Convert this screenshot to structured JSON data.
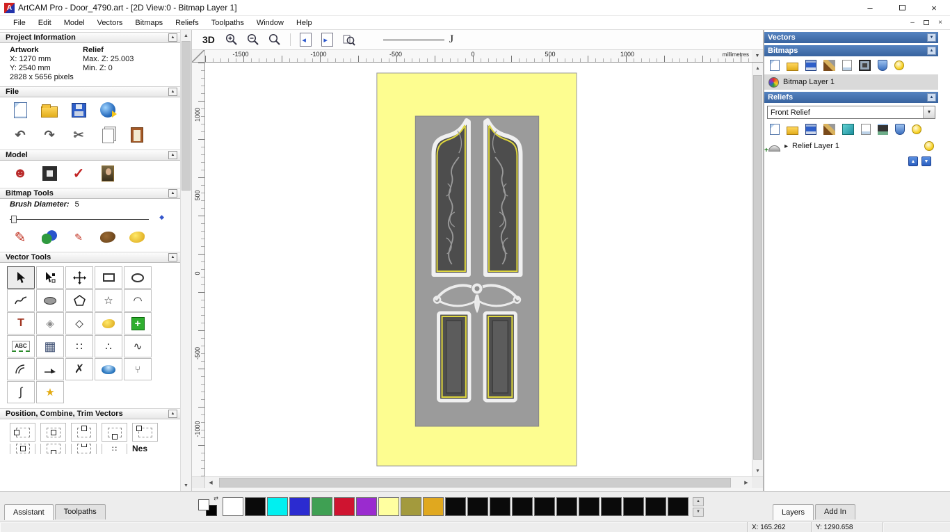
{
  "window": {
    "title": "ArtCAM Pro - Door_4790.art - [2D View:0 - Bitmap Layer 1]",
    "menus": [
      "File",
      "Edit",
      "Model",
      "Vectors",
      "Bitmaps",
      "Reliefs",
      "Toolpaths",
      "Window",
      "Help"
    ]
  },
  "icons": {
    "minimize": "–",
    "close": "×",
    "mdi-minimize": "–",
    "mdi-close": "×",
    "collapse": "▲",
    "expand": "▼",
    "undo": "↶",
    "redo": "↷",
    "cut": "✂",
    "scroll-up": "▲",
    "scroll-down": "▼",
    "scroll-left": "◀",
    "scroll-right": "▶",
    "star-outline": "☆",
    "star-gold": "★",
    "diamond-gray": "◈",
    "diamond-white": "◇",
    "grid": "▦",
    "dots": "∷",
    "nodes": "∴",
    "wave": "∿",
    "arc": "◠",
    "text-tool": "T",
    "abc": "ABC",
    "check-red": "✓",
    "face": "☻",
    "pencil": "✎",
    "x-tool": "✗",
    "expander": "▸",
    "unit-drop": "▼",
    "swap": "⇄",
    "layer-up": "▲",
    "layer-down": "▼",
    "zoom-plus": "+",
    "zoom-minus": "−",
    "fern": "⑂",
    "scurve": "∫"
  },
  "left_panel": {
    "project_info": {
      "title": "Project Information",
      "artwork_heading": "Artwork",
      "relief_heading": "Relief",
      "artwork_x": "X: 1270 mm",
      "artwork_y": "Y: 2540 mm",
      "artwork_pixels": "2828 x 5656 pixels",
      "relief_max": "Max. Z: 25.003",
      "relief_min": "Min. Z: 0"
    },
    "file_section": {
      "title": "File"
    },
    "model_section": {
      "title": "Model"
    },
    "bitmap_tools": {
      "title": "Bitmap Tools",
      "brush_label": "Brush Diameter:",
      "brush_value": "5"
    },
    "vector_tools": {
      "title": "Vector Tools"
    },
    "position_section": {
      "title": "Position, Combine, Trim Vectors",
      "nest_label": "Nes"
    },
    "tabs": [
      {
        "label": "Assistant"
      },
      {
        "label": "Toolpaths"
      }
    ]
  },
  "canvas": {
    "toolbar": {
      "btn_3d": "3D"
    },
    "ruler_unit": "millimetres",
    "h_ruler": {
      "labels": [
        "-1500",
        "-1000",
        "-500",
        "0",
        "500",
        "1000"
      ],
      "positions": [
        51,
        163,
        274,
        385,
        496,
        607
      ]
    },
    "v_ruler": {
      "labels": [
        "1000",
        "500",
        "0",
        "-500",
        "-1000"
      ],
      "positions": [
        70,
        186,
        298,
        413,
        522
      ]
    }
  },
  "right_panel": {
    "vectors": {
      "title": "Vectors"
    },
    "bitmaps": {
      "title": "Bitmaps",
      "layer_name": "Bitmap Layer 1"
    },
    "reliefs": {
      "title": "Reliefs",
      "dropdown_value": "Front Relief",
      "layer_name": "Relief Layer 1"
    },
    "tabs": [
      {
        "label": "Layers"
      },
      {
        "label": "Add In"
      }
    ]
  },
  "palette": {
    "colors": [
      "#ffffff",
      "#0a0a0a",
      "#00f0f0",
      "#2b2bd0",
      "#3fa053",
      "#cf1430",
      "#9a2bcf",
      "#ffffa0",
      "#a39a3d",
      "#e0a81f",
      "#0a0a0a",
      "#0a0a0a",
      "#0a0a0a",
      "#0a0a0a",
      "#0a0a0a",
      "#0a0a0a",
      "#0a0a0a",
      "#0a0a0a",
      "#0a0a0a",
      "#0a0a0a",
      "#0a0a0a"
    ]
  },
  "status_bar": {
    "x": "X: 165.262",
    "y": "Y: 1290.658"
  }
}
